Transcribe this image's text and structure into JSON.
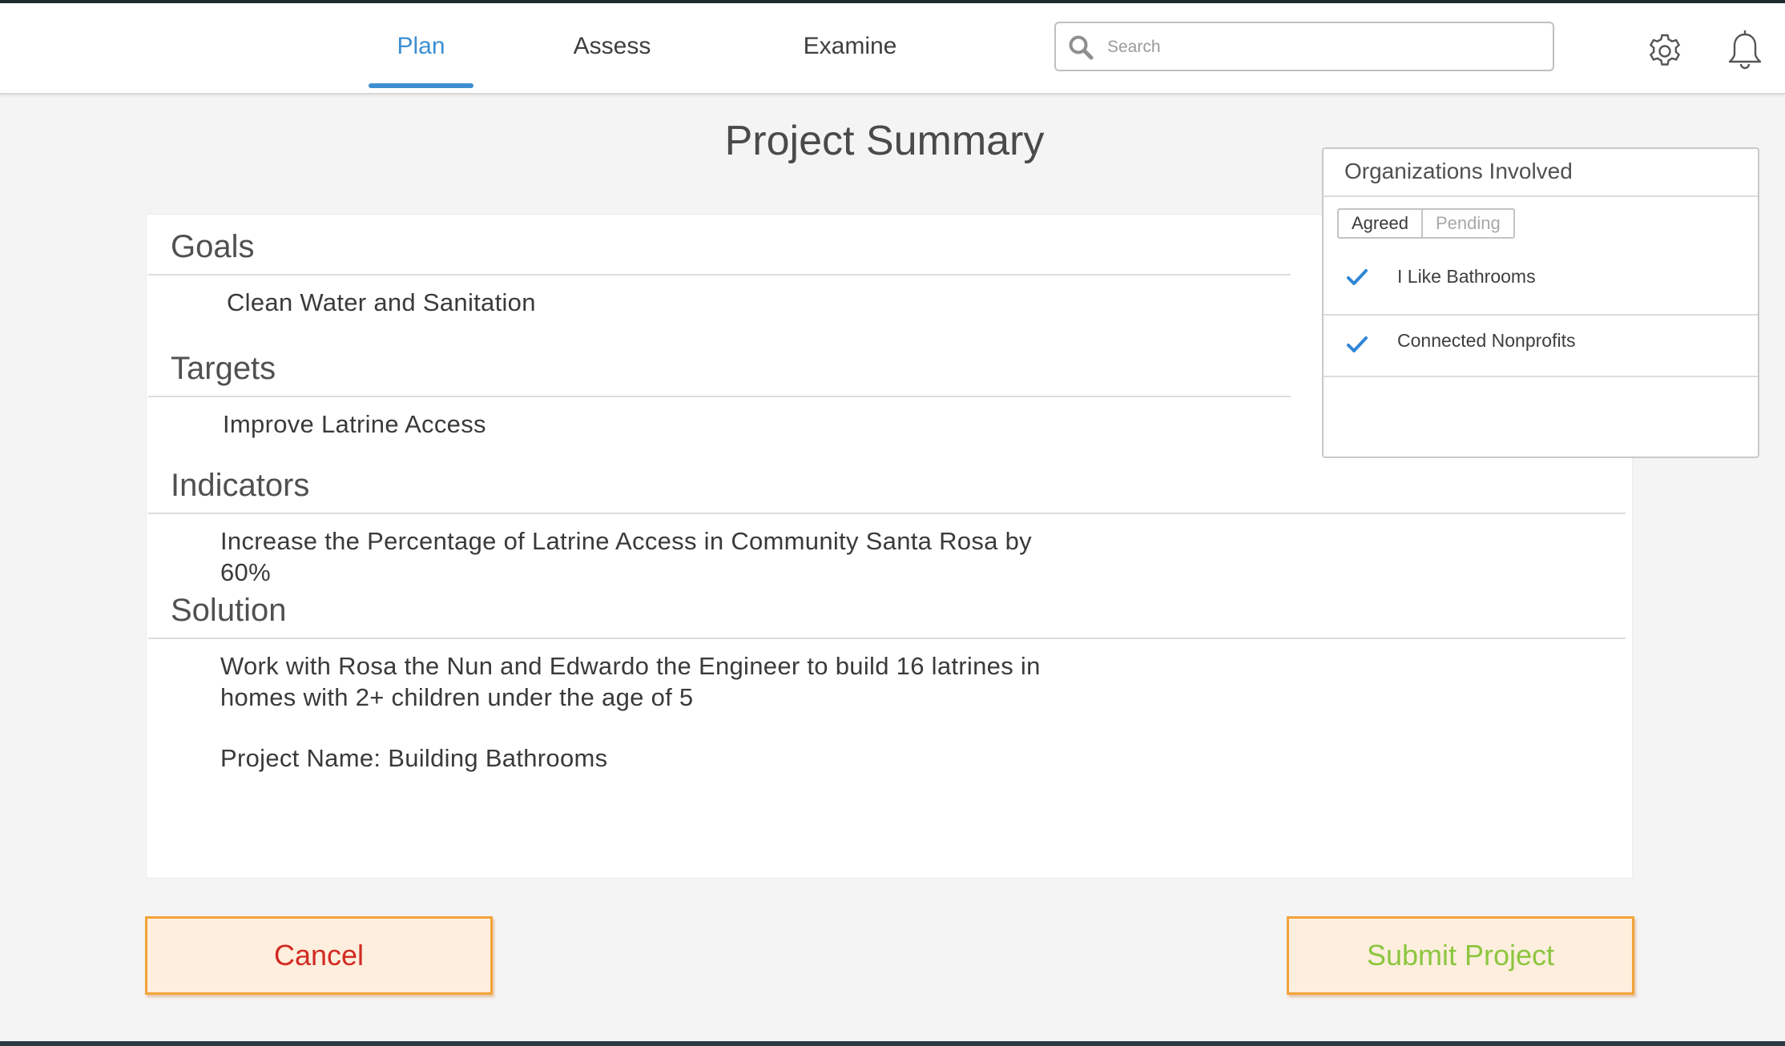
{
  "nav": {
    "tabs": [
      {
        "label": "Plan",
        "active": true
      },
      {
        "label": "Assess",
        "active": false
      },
      {
        "label": "Examine",
        "active": false
      }
    ],
    "search_placeholder": "Search",
    "icons": [
      "search-icon",
      "gear-icon",
      "bell-icon"
    ]
  },
  "page": {
    "title": "Project Summary"
  },
  "summary": {
    "goals": {
      "heading": "Goals",
      "text": "Clean Water and Sanitation"
    },
    "targets": {
      "heading": "Targets",
      "text": "Improve Latrine Access"
    },
    "indicators": {
      "heading": "Indicators",
      "line1": "Increase the Percentage of Latrine Access in Community Santa Rosa by",
      "line2": "60%"
    },
    "solution": {
      "heading": "Solution",
      "line1": "Work with Rosa the Nun and Edwardo the Engineer to build 16 latrines in",
      "line2": "homes with 2+ children under the age of 5"
    },
    "project_name": "Project Name: Building Bathrooms"
  },
  "organizations": {
    "title": "Organizations Involved",
    "tabs": {
      "agreed": "Agreed",
      "pending": "Pending",
      "selected": "Agreed"
    },
    "items": [
      {
        "name": "I Like Bathrooms",
        "checked": true
      },
      {
        "name": "Connected Nonprofits",
        "checked": true
      }
    ]
  },
  "actions": {
    "cancel": "Cancel",
    "submit": "Submit Project"
  },
  "colors": {
    "accent": "#3d8fd1",
    "cancel_text": "#d22a22",
    "submit_text": "#8cc63f",
    "button_border": "#f2a33a",
    "button_fill": "#fdeedd"
  }
}
